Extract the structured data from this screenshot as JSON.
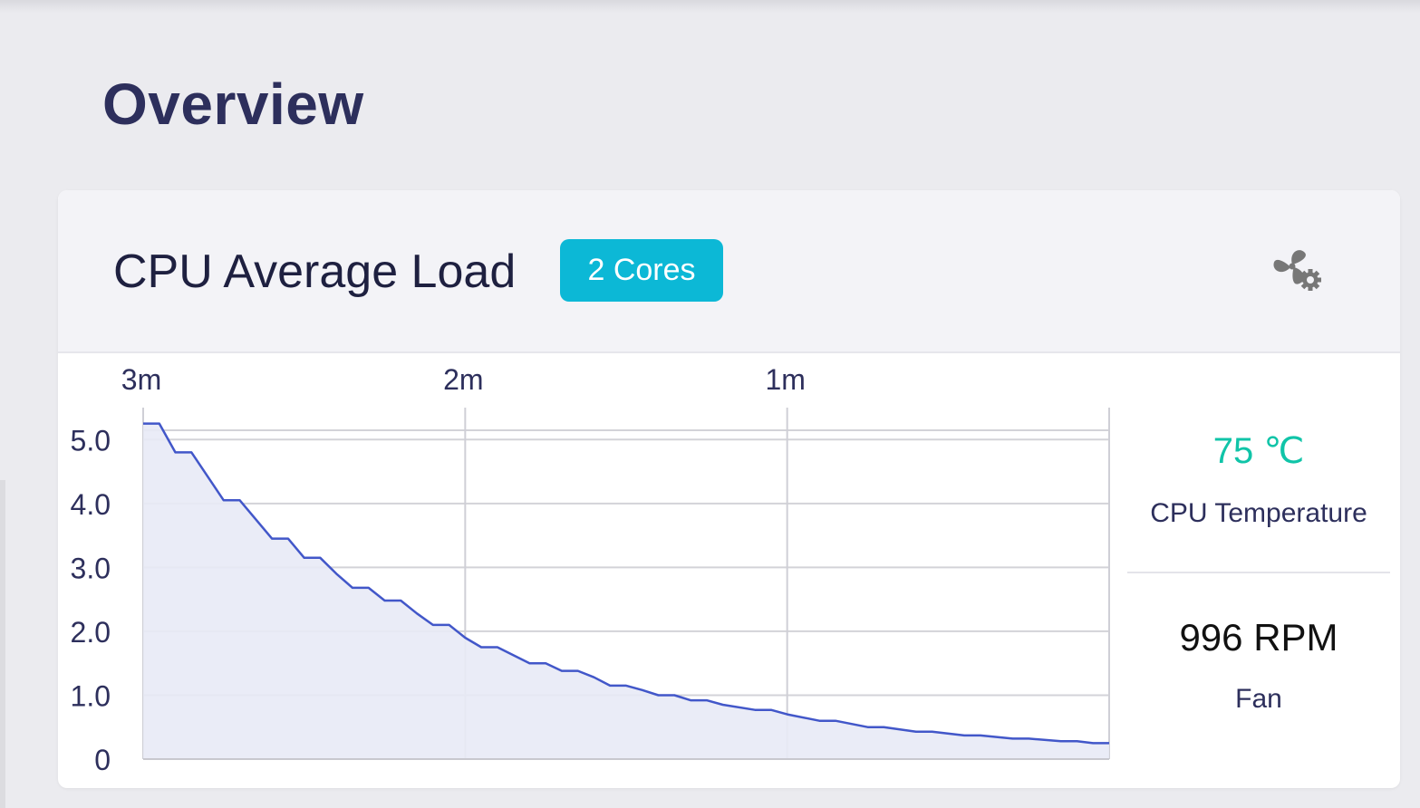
{
  "page": {
    "title": "Overview"
  },
  "card": {
    "title": "CPU Average Load",
    "badge": "2 Cores",
    "fan_icon": "fan-settings-icon"
  },
  "stats": {
    "temperature_value": "75 ℃",
    "temperature_label": "CPU Temperature",
    "fan_value": "996 RPM",
    "fan_label": "Fan"
  },
  "colors": {
    "accent_badge": "#0cb8d6",
    "temperature": "#10c4a8",
    "line": "#4257c9",
    "area": "#e8eaf6",
    "title": "#2d2f5c"
  },
  "chart_data": {
    "type": "area",
    "title": "",
    "xlabel": "",
    "ylabel": "",
    "x_unit": "minutes ago",
    "xlim": [
      3,
      0
    ],
    "ylim": [
      0,
      5.5
    ],
    "x_ticks": [
      {
        "value": 3,
        "label": "3m"
      },
      {
        "value": 2,
        "label": "2m"
      },
      {
        "value": 1,
        "label": "1m"
      }
    ],
    "y_ticks": [
      {
        "value": 0,
        "label": "0"
      },
      {
        "value": 1,
        "label": "1.0"
      },
      {
        "value": 2,
        "label": "2.0"
      },
      {
        "value": 3,
        "label": "3.0"
      },
      {
        "value": 4,
        "label": "4.0"
      },
      {
        "value": 5,
        "label": "5.0"
      }
    ],
    "grid": true,
    "series": [
      {
        "x": [
          3.0,
          2.95,
          2.9,
          2.85,
          2.75,
          2.7,
          2.6,
          2.55,
          2.5,
          2.45,
          2.4,
          2.35,
          2.3,
          2.25,
          2.2,
          2.15,
          2.1,
          2.05,
          2.0,
          1.95,
          1.9,
          1.8,
          1.75,
          1.7,
          1.65,
          1.6,
          1.55,
          1.5,
          1.45,
          1.4,
          1.35,
          1.3,
          1.25,
          1.2,
          1.1,
          1.05,
          1.0,
          0.9,
          0.85,
          0.75,
          0.7,
          0.6,
          0.55,
          0.45,
          0.4,
          0.3,
          0.25,
          0.15,
          0.1,
          0.05,
          0.0
        ],
        "values": [
          5.25,
          5.25,
          4.8,
          4.8,
          4.05,
          4.05,
          3.45,
          3.45,
          3.15,
          3.15,
          2.9,
          2.68,
          2.68,
          2.48,
          2.48,
          2.28,
          2.1,
          2.1,
          1.9,
          1.75,
          1.75,
          1.5,
          1.5,
          1.38,
          1.38,
          1.28,
          1.15,
          1.15,
          1.08,
          1.0,
          1.0,
          0.92,
          0.92,
          0.85,
          0.77,
          0.77,
          0.7,
          0.6,
          0.6,
          0.5,
          0.5,
          0.43,
          0.43,
          0.37,
          0.37,
          0.32,
          0.32,
          0.28,
          0.28,
          0.25,
          0.25
        ]
      }
    ]
  }
}
